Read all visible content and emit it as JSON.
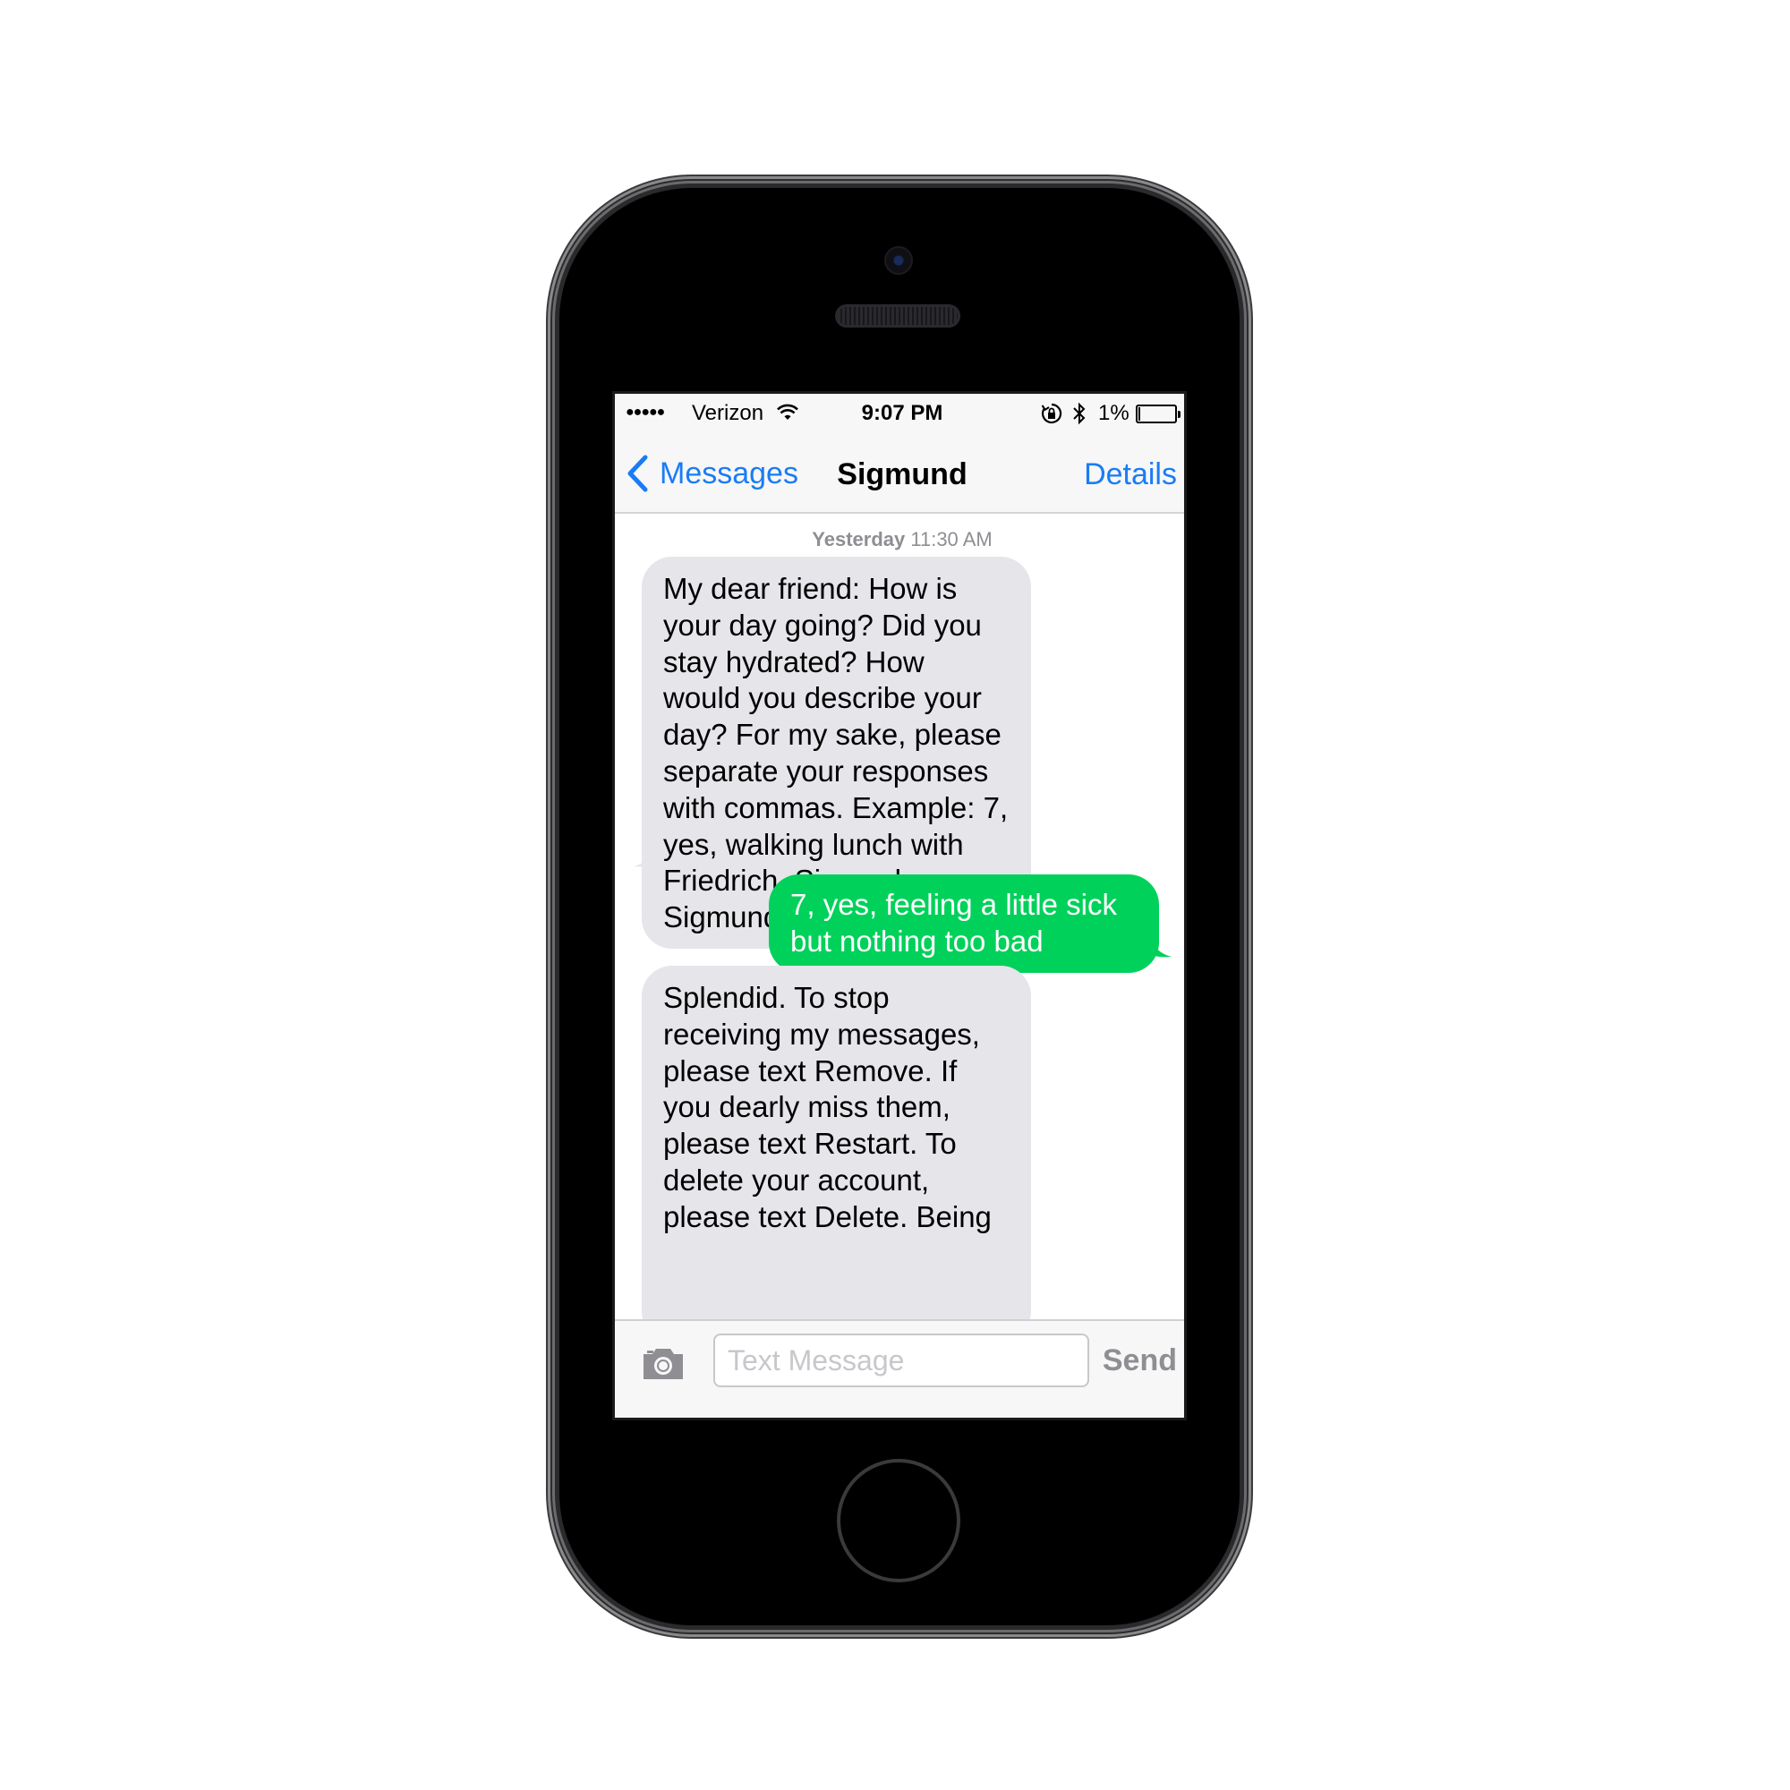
{
  "status_bar": {
    "signal": "●●●●●",
    "carrier": "Verizon",
    "time": "9:07 PM",
    "battery_percent": "1%",
    "battery_level": 0.01,
    "icons": [
      "wifi-icon",
      "rotation-lock-icon",
      "bluetooth-icon",
      "battery-icon"
    ]
  },
  "nav": {
    "back_label": "Messages",
    "title": "Sigmund",
    "details_label": "Details"
  },
  "thread": {
    "timestamp_day": "Yesterday",
    "timestamp_time": "11:30 AM",
    "messages": [
      {
        "direction": "incoming",
        "text": "My dear friend: How is your day going? Did you stay hydrated? How would you describe your day? For my sake, please separate your responses with commas. Example: 7, yes, walking lunch with Friedrich. Sincerely, Sigmund"
      },
      {
        "direction": "outgoing",
        "text": "7, yes, feeling a little sick but nothing too bad"
      },
      {
        "direction": "incoming",
        "text": "Splendid. To stop receiving my messages, please text Remove. If you dearly miss them, please text Restart. To delete your account, please text Delete. Being"
      }
    ]
  },
  "input": {
    "placeholder": "Text Message",
    "value": "",
    "send_label": "Send"
  },
  "colors": {
    "accent_blue": "#1a7cf5",
    "incoming_bubble": "#e5e5ea",
    "outgoing_bubble": "#00d15a",
    "timestamp_gray": "#8e8e93"
  }
}
